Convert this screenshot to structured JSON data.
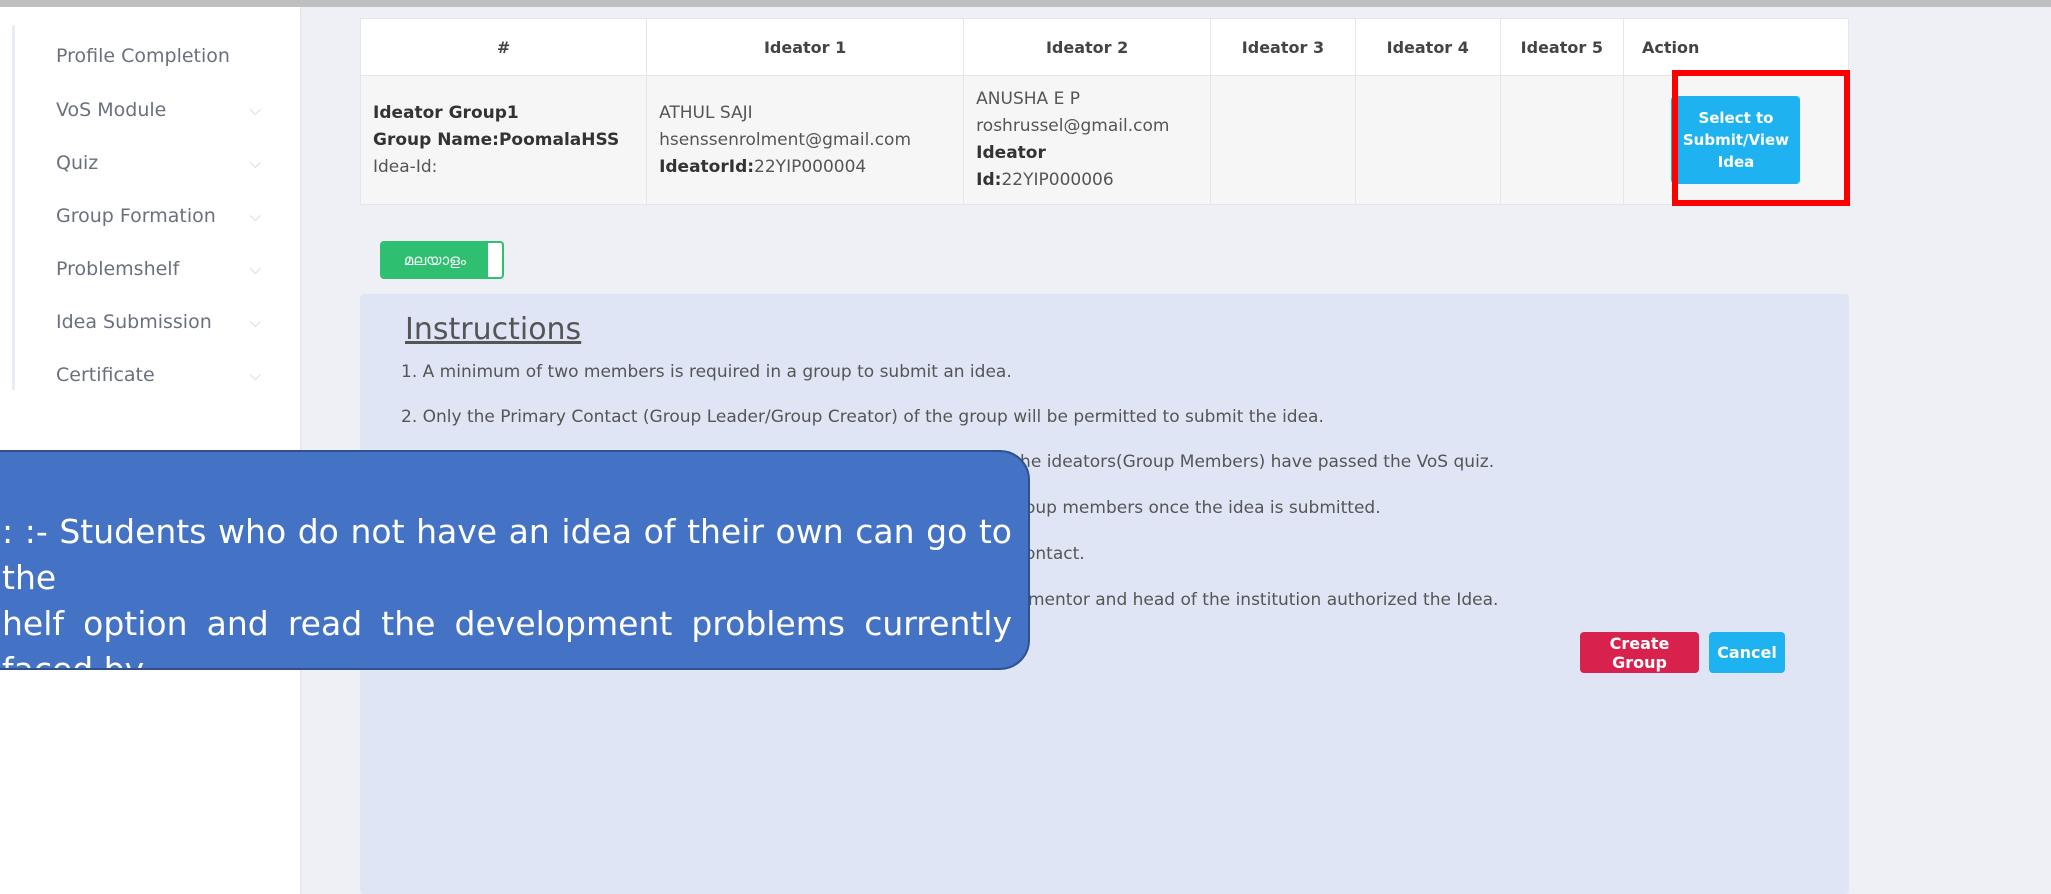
{
  "sidebar": {
    "items": [
      {
        "label": "Profile Completion",
        "has_chevron": false
      },
      {
        "label": "VoS Module",
        "has_chevron": true
      },
      {
        "label": "Quiz",
        "has_chevron": true
      },
      {
        "label": "Group Formation",
        "has_chevron": true
      },
      {
        "label": "Problemshelf",
        "has_chevron": true
      },
      {
        "label": "Idea Submission",
        "has_chevron": true
      },
      {
        "label": "Certificate",
        "has_chevron": true
      }
    ],
    "chevron_glyph": "⌵"
  },
  "table": {
    "headers": [
      "#",
      "Ideator 1",
      "Ideator 2",
      "Ideator 3",
      "Ideator 4",
      "Ideator 5",
      "Action"
    ],
    "row": {
      "group": {
        "name": "Ideator Group1",
        "group_name": "Group Name:PoomalaHSS",
        "idea_id": "Idea-Id:"
      },
      "ideator1": {
        "name": "ATHUL SAJI",
        "email": "hsenssenrolment@gmail.com",
        "id_label": "IdeatorId:",
        "id_value": "22YIP000004"
      },
      "ideator2": {
        "name": "ANUSHA E P",
        "email": "roshrussel@gmail.com",
        "id_label_1": "Ideator",
        "id_label_2": "Id:",
        "id_value": "22YIP000006"
      },
      "action_button": "Select to Submit/View Idea"
    }
  },
  "language_toggle": {
    "label": "മലയാളം"
  },
  "instructions": {
    "title": "Instructions",
    "lines": [
      "1. A minimum of two members is required in a group to submit an idea.",
      "2. Only the Primary Contact (Group Leader/Group Creator) of the group will be permitted to submit the idea.",
      "f the ideators(Group Members) have passed the VoS quiz.",
      "oup members once the idea is submitted.",
      "ontact.",
      "mentor and head of the institution authorized the Idea."
    ]
  },
  "buttons": {
    "create": "Create Group",
    "cancel": "Cancel"
  },
  "callout": {
    "text": ": :- Students who do not have an idea of their own can go to the\nhelf option and read the development problems currently faced by\nd suggest solutions."
  },
  "colors": {
    "accent_blue": "#1eb3f0",
    "create_red": "#d9214e",
    "lang_green": "#2fbf71",
    "highlight_red": "#ff0000",
    "callout_blue": "#4472c4"
  }
}
